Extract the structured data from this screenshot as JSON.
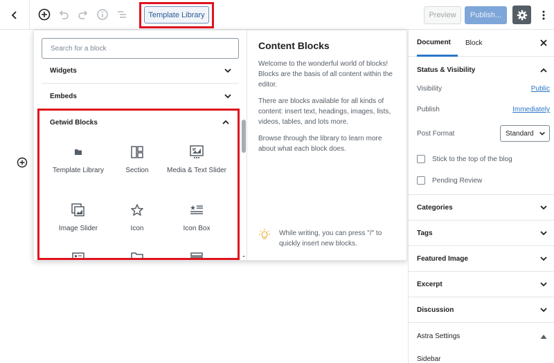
{
  "toolbar": {
    "template_library_label": "Template Library",
    "preview_label": "Preview",
    "publish_label": "Publish..."
  },
  "inserter": {
    "search_placeholder": "Search for a block",
    "panels": [
      {
        "label": "Widgets"
      },
      {
        "label": "Embeds"
      }
    ],
    "getwid": {
      "title": "Getwid Blocks",
      "blocks": [
        {
          "label": "Template Library",
          "icon": "folder-icon"
        },
        {
          "label": "Section",
          "icon": "section-icon"
        },
        {
          "label": "Media & Text Slider",
          "icon": "media-text-slider-icon"
        },
        {
          "label": "Image Slider",
          "icon": "image-slider-icon"
        },
        {
          "label": "Icon",
          "icon": "star-icon"
        },
        {
          "label": "Icon Box",
          "icon": "icon-box-icon"
        }
      ]
    },
    "info": {
      "title": "Content Blocks",
      "p1": "Welcome to the wonderful world of blocks! Blocks are the basis of all content within the editor.",
      "p2": "There are blocks available for all kinds of content: insert text, headings, images, lists, videos, tables, and lots more.",
      "p3": "Browse through the library to learn more about what each block does.",
      "tip": "While writing, you can press \"/\" to quickly insert new blocks."
    }
  },
  "sidebar": {
    "tabs": [
      "Document",
      "Block"
    ],
    "status": {
      "title": "Status & Visibility",
      "visibility_label": "Visibility",
      "visibility_value": "Public",
      "publish_label": "Publish",
      "publish_value": "Immediately",
      "format_label": "Post Format",
      "format_value": "Standard",
      "sticky_label": "Stick to the top of the blog",
      "pending_label": "Pending Review"
    },
    "sections": [
      "Categories",
      "Tags",
      "Featured Image",
      "Excerpt",
      "Discussion"
    ],
    "astra": {
      "title": "Astra Settings",
      "sub": "Sidebar"
    }
  },
  "colors": {
    "accent": "#2b77c6",
    "highlight": "#e0121d"
  }
}
